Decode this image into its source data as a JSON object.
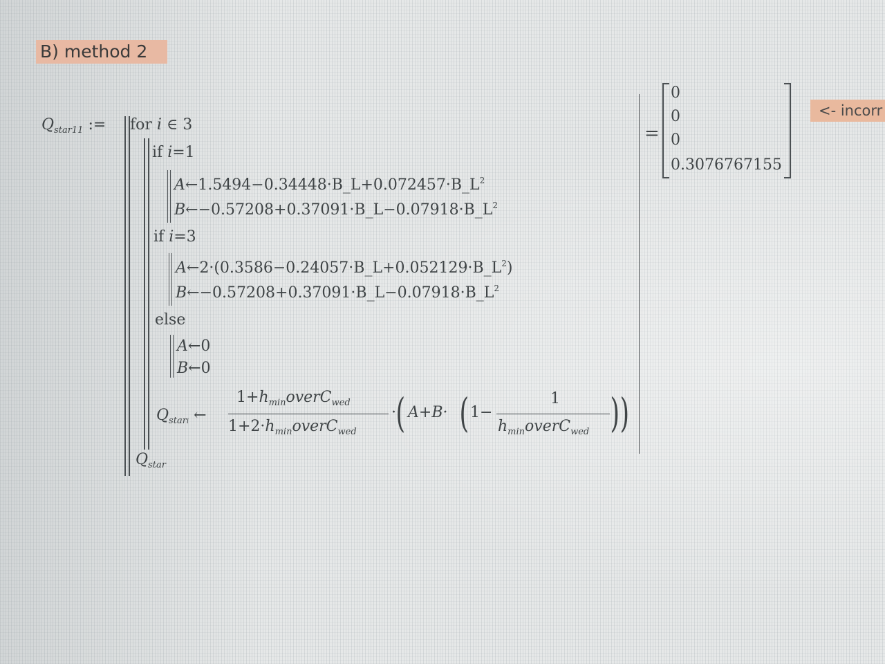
{
  "section_label": "B) method 2",
  "note_label": "<- incorr",
  "definition": {
    "lhs_var": "Q",
    "lhs_sub": "star11",
    "assign_op": ":="
  },
  "program": {
    "for_kw": "for",
    "loop_var": "i",
    "in_op": "∈",
    "loop_range": "3",
    "if1_kw": "if",
    "if1_var": "i",
    "if1_cond": "=1",
    "l1_a": "A",
    "l1_a_expr": "←1.5494−0.34448·B_L+0.072457·B_L",
    "l1_b": "B",
    "l1_b_expr": "←−0.57208+0.37091·B_L−0.07918·B_L",
    "if2_kw": "if",
    "if2_var": "i",
    "if2_cond": "=3",
    "l2_a": "A",
    "l2_a_expr": "←2·(0.3586−0.24057·B_L+0.052129·B_L",
    "l2_a_close": ")",
    "l2_b": "B",
    "l2_b_expr": "←−0.57208+0.37091·B_L−0.07918·B_L",
    "else_kw": "else",
    "l3_a": "A",
    "l3_a_expr": "←0",
    "l3_b": "B",
    "l3_b_expr": "←0",
    "square": "2",
    "q_var": "Q",
    "q_sub": "star",
    "q_sub_index": "i",
    "q_arrow": "←",
    "num1": "1+",
    "num_h": "h",
    "num_h_sub": "min",
    "num_over": "overC",
    "num_wed": "wed",
    "den1": "1+2·",
    "den_h": "h",
    "den_h_sub": "min",
    "den_over": "overC",
    "den_wed": "wed",
    "mult": "·",
    "paren_inner": "A+B·",
    "one": "1",
    "minus": "−",
    "frac2_num": "1",
    "frac2_h": "h",
    "frac2_h_sub": "min",
    "frac2_over": "overC",
    "frac2_wed": "wed",
    "return_var": "Q",
    "return_sub": "star"
  },
  "result": {
    "eq": "=",
    "values": [
      "0",
      "0",
      "0",
      "0.3076767155"
    ]
  }
}
